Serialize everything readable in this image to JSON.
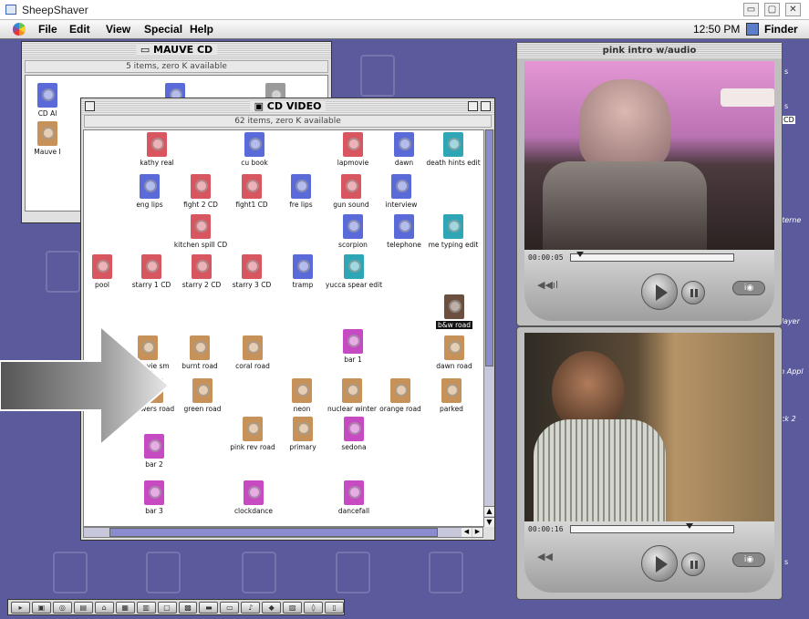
{
  "host": {
    "title": "SheepShaver",
    "buttons": [
      "▭",
      "▢",
      "✕"
    ]
  },
  "menubar": {
    "items": [
      "File",
      "Edit",
      "View",
      "Special",
      "Help"
    ],
    "clock": "12:50 PM",
    "app": "Finder"
  },
  "mauve_cd": {
    "title": "MAUVE CD",
    "info": "5 items, zero K available",
    "icons": [
      {
        "label": "CD Al"
      },
      {
        "label": "Mauve I"
      }
    ]
  },
  "cd_video": {
    "title": "CD VIDEO",
    "info": "62 items, zero K available",
    "icons": [
      {
        "label": "kathy real"
      },
      {
        "label": "cu book"
      },
      {
        "label": "lapmovie"
      },
      {
        "label": "dawn"
      },
      {
        "label": "death hints edit"
      },
      {
        "label": "eng lips"
      },
      {
        "label": "fight 2 CD"
      },
      {
        "label": "fight1 CD"
      },
      {
        "label": "fre lips"
      },
      {
        "label": "gun sound"
      },
      {
        "label": "interview"
      },
      {
        "label": "kitchen spill CD"
      },
      {
        "label": "scorpion"
      },
      {
        "label": "telephone"
      },
      {
        "label": "me typing edit"
      },
      {
        "label": "pool"
      },
      {
        "label": "starry 1 CD"
      },
      {
        "label": "starry 2 CD"
      },
      {
        "label": "starry 3 CD"
      },
      {
        "label": "tramp"
      },
      {
        "label": "yucca spear edit"
      },
      {
        "label": "b&w road"
      },
      {
        "label": "ck movie sm"
      },
      {
        "label": "burnt road"
      },
      {
        "label": "coral road"
      },
      {
        "label": "bar 1"
      },
      {
        "label": "dawn road"
      },
      {
        "label": "flowers road"
      },
      {
        "label": "green road"
      },
      {
        "label": "neon"
      },
      {
        "label": "nuclear winter"
      },
      {
        "label": "orange road"
      },
      {
        "label": "parked"
      },
      {
        "label": "pink rev road"
      },
      {
        "label": "primary"
      },
      {
        "label": "sedona"
      },
      {
        "label": "bar 2"
      },
      {
        "label": "bar 3"
      },
      {
        "label": "clockdance"
      },
      {
        "label": "dancefall"
      }
    ]
  },
  "movie1": {
    "title": "pink intro w/audio",
    "time": "00:00:05",
    "progress": 0.05
  },
  "movie2": {
    "time": "00:00:16",
    "progress": 0.7
  },
  "desktop_labels": [
    "s",
    "s",
    "CD",
    "nterne",
    "Player",
    "th Appl",
    "ck 2",
    "s"
  ],
  "controlstrip": {
    "count": 17
  }
}
